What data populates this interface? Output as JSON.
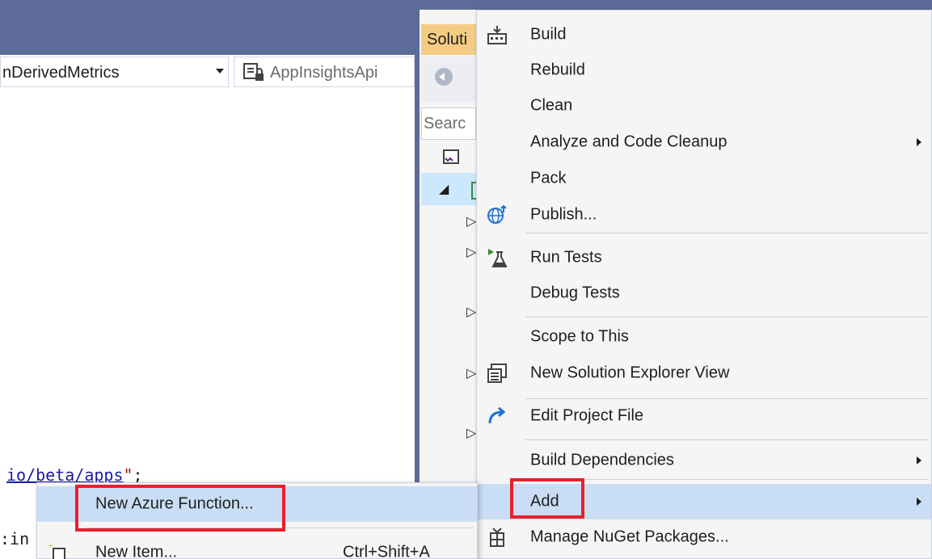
{
  "editor": {
    "member_dropdown": "nDerivedMetrics",
    "project_dropdown": "AppInsightsApi",
    "code_url_link": "io/beta/apps",
    "code_url_quote": "\"",
    "code_url_semicolon": ";",
    "code_fragment": ":in"
  },
  "solution_explorer": {
    "tab_label": "Soluti",
    "search_placeholder": "Searc"
  },
  "context_menu": {
    "build": "Build",
    "rebuild": "Rebuild",
    "clean": "Clean",
    "analyze": "Analyze and Code Cleanup",
    "pack": "Pack",
    "publish": "Publish...",
    "run_tests": "Run Tests",
    "debug_tests": "Debug Tests",
    "scope": "Scope to This",
    "new_view": "New Solution Explorer View",
    "edit_project": "Edit Project File",
    "build_deps": "Build Dependencies",
    "add": "Add",
    "manage_nuget": "Manage NuGet Packages..."
  },
  "add_submenu": {
    "new_azure_function": "New Azure Function...",
    "new_item": "New Item...",
    "new_item_shortcut": "Ctrl+Shift+A"
  },
  "colors": {
    "title_bar": "#5d6b99",
    "menu_background": "#f5f5f5",
    "highlight": "#c9def5",
    "annotation_red": "#e8202a",
    "tab_yellow": "#f5cc84"
  }
}
